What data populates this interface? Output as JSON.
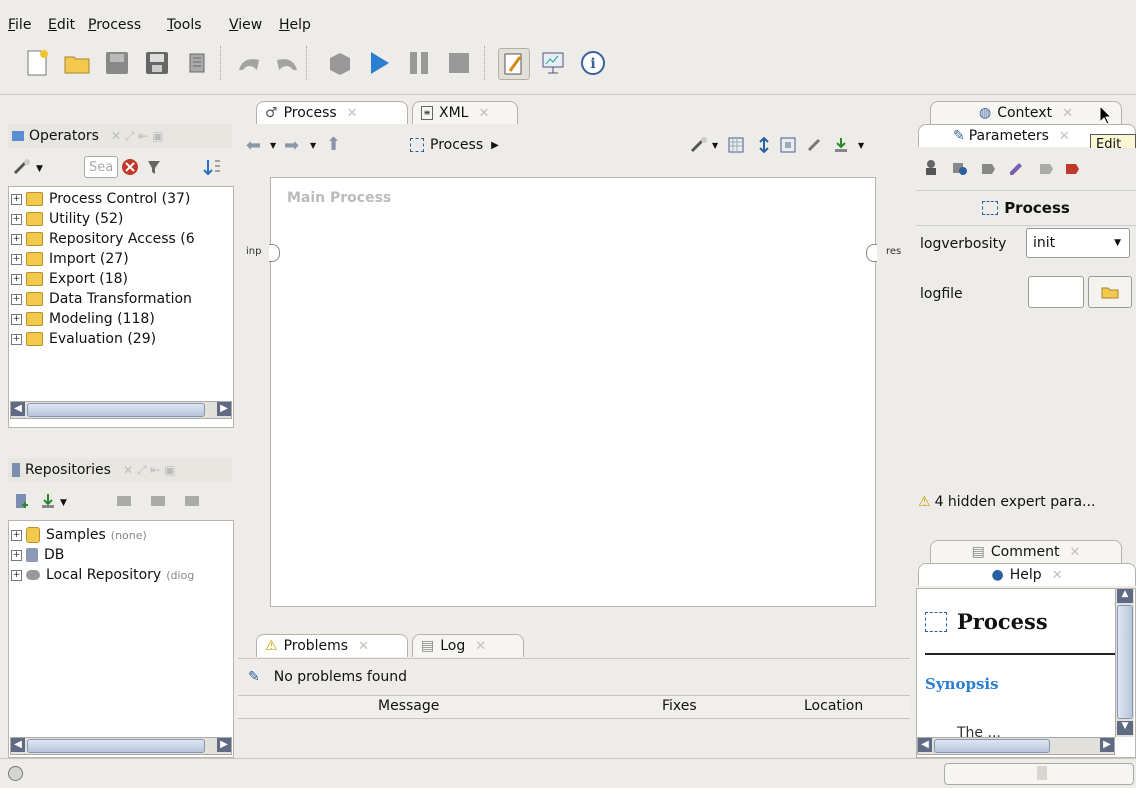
{
  "menu": [
    {
      "first": "F",
      "rest": "ile"
    },
    {
      "first": "E",
      "rest": "dit"
    },
    {
      "first": "P",
      "rest": "rocess"
    },
    {
      "first": "T",
      "rest": "ools"
    },
    {
      "first": "V",
      "rest": "iew"
    },
    {
      "first": "H",
      "rest": "elp"
    }
  ],
  "operators": {
    "title": "Operators",
    "search_placeholder": "Sea",
    "items": [
      {
        "label": "Process Control (37)"
      },
      {
        "label": "Utility (52)"
      },
      {
        "label": "Repository Access (6"
      },
      {
        "label": "Import (27)"
      },
      {
        "label": "Export (18)"
      },
      {
        "label": "Data Transformation"
      },
      {
        "label": "Modeling (118)"
      },
      {
        "label": "Evaluation (29)"
      }
    ]
  },
  "repositories": {
    "title": "Repositories",
    "items": [
      {
        "label": "Samples",
        "note": "(none)"
      },
      {
        "label": "DB",
        "note": ""
      },
      {
        "label": "Local Repository",
        "note": "(diog"
      }
    ]
  },
  "center": {
    "tabs": [
      {
        "label": "Process"
      },
      {
        "label": "XML"
      }
    ],
    "breadcrumb": "Process",
    "canvas_title": "Main Process",
    "port_left": "inp",
    "port_right": "res"
  },
  "bottom": {
    "tabs": [
      {
        "label": "Problems"
      },
      {
        "label": "Log"
      }
    ],
    "status": "No problems found",
    "columns": [
      "Message",
      "Fixes",
      "Location"
    ]
  },
  "right": {
    "tabs_top": [
      {
        "label": "Context"
      },
      {
        "label": "Parameters"
      }
    ],
    "tooltip": "Edit",
    "operator_name": "Process",
    "params": [
      {
        "name": "logverbosity",
        "value": "init"
      },
      {
        "name": "logfile",
        "value": ""
      }
    ],
    "hidden_note": "4 hidden expert para...",
    "tabs_bottom": [
      {
        "label": "Comment"
      },
      {
        "label": "Help"
      }
    ],
    "help_title": "Process",
    "help_section": "Synopsis",
    "help_text": "The ... "
  }
}
